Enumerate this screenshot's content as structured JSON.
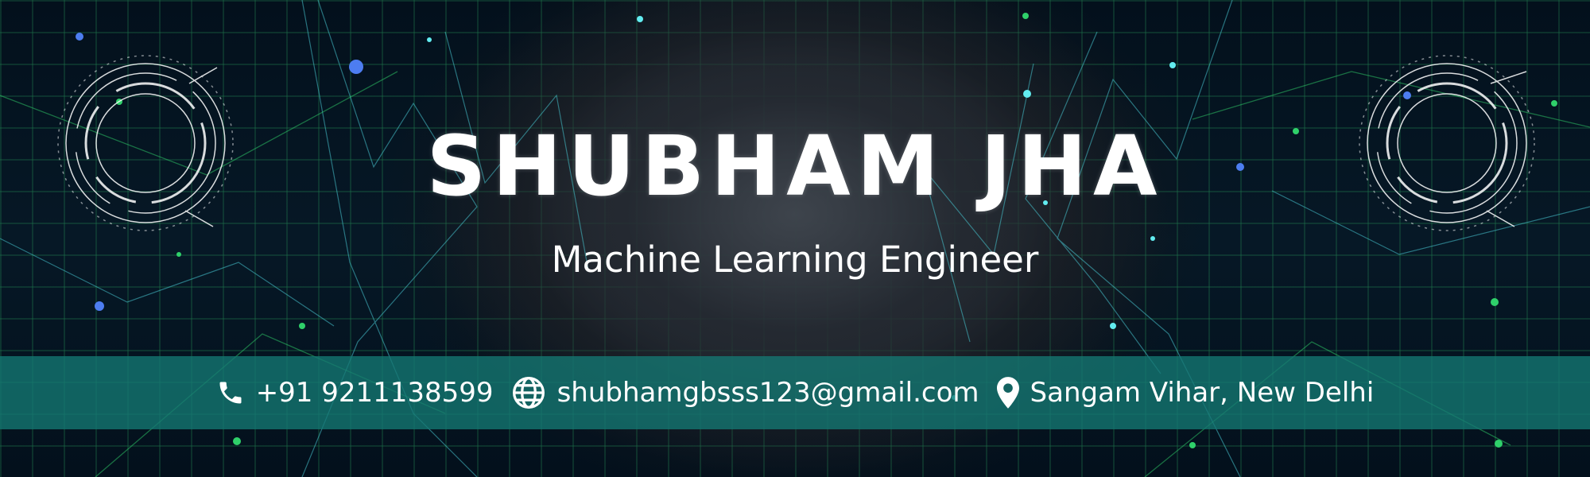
{
  "banner": {
    "name": "SHUBHAM JHA",
    "title": "Machine Learning Engineer"
  },
  "contacts": {
    "phone": {
      "icon": "phone-icon",
      "value": "+91 9211138599"
    },
    "email": {
      "icon": "globe-icon",
      "value": "shubhamgbsss123@gmail.com"
    },
    "location": {
      "icon": "map-pin-icon",
      "value": "Sangam Vihar, New Delhi"
    }
  },
  "colors": {
    "bar": "#14786f",
    "grid": "#2a9660",
    "accent": "#5fe0e6",
    "text": "#ffffff"
  }
}
